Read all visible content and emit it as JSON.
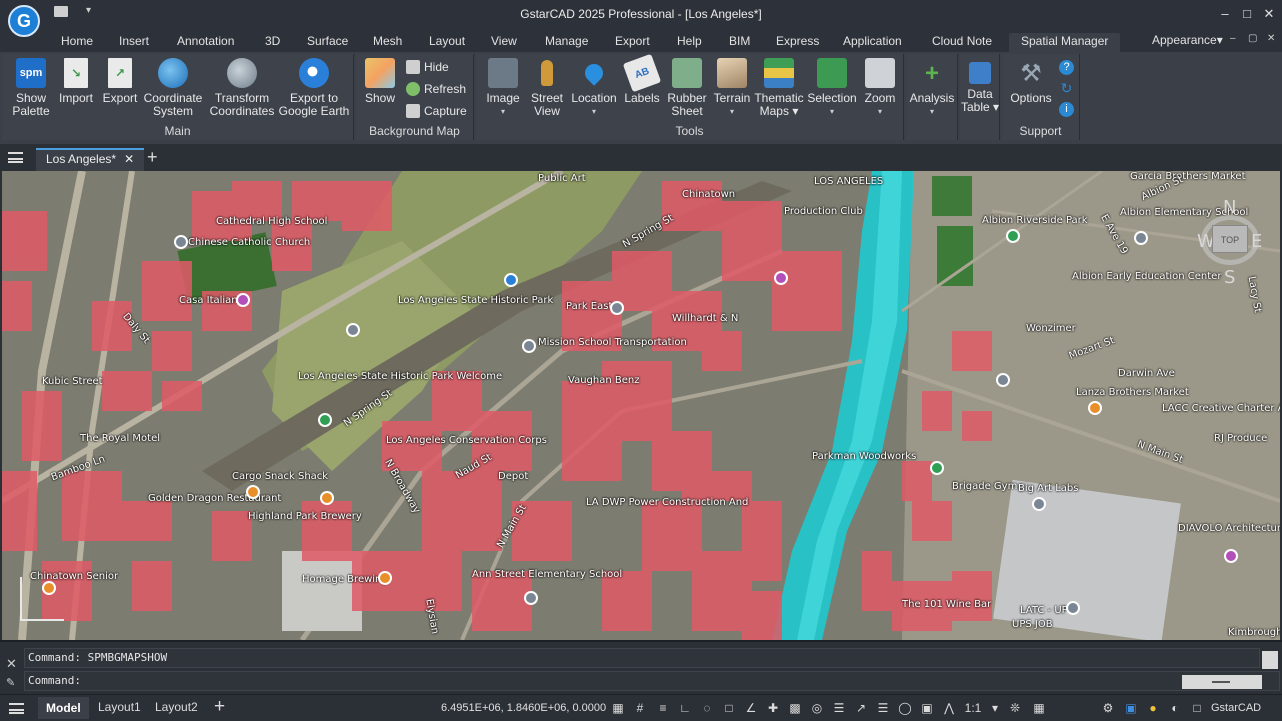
{
  "title_bar": {
    "title": "GstarCAD 2025 Professional - [Los Angeles*]",
    "logo_letter": "G",
    "quick_access_arrow": "▾",
    "window_buttons": [
      "–",
      "□",
      "✕"
    ]
  },
  "ribbon_tabs": [
    {
      "label": "Home",
      "active": false
    },
    {
      "label": "Insert",
      "active": false
    },
    {
      "label": "Annotation",
      "active": false
    },
    {
      "label": "3D",
      "active": false
    },
    {
      "label": "Surface",
      "active": false
    },
    {
      "label": "Mesh",
      "active": false
    },
    {
      "label": "Layout",
      "active": false
    },
    {
      "label": "View",
      "active": false
    },
    {
      "label": "Manage",
      "active": false
    },
    {
      "label": "Export",
      "active": false
    },
    {
      "label": "Help",
      "active": false
    },
    {
      "label": "BIM",
      "active": false
    },
    {
      "label": "Express",
      "active": false
    },
    {
      "label": "Application",
      "active": false
    },
    {
      "label": "Cloud Note",
      "active": false
    },
    {
      "label": "Spatial Manager",
      "active": true
    }
  ],
  "appearance_menu": "Appearance",
  "appearance_arrow": "▾",
  "ribbon_window_buttons": [
    "–",
    "▢",
    "✕"
  ],
  "panels": {
    "main": {
      "title": "Main",
      "buttons": [
        {
          "line1": "Show",
          "line2": "Palette",
          "icon": "spm",
          "icon_color": "#1f6fc9"
        },
        {
          "line1": "Import",
          "line2": "",
          "icon": "",
          "icon_color": "#e8e8e8"
        },
        {
          "line1": "Export",
          "line2": "",
          "icon": "",
          "icon_color": "#e8e8e8"
        },
        {
          "line1": "Coordinate",
          "line2": "System",
          "icon": "",
          "icon_color": "#2a8ad4"
        },
        {
          "line1": "Transform",
          "line2": "Coordinates",
          "icon": "",
          "icon_color": "#8a9aa8"
        },
        {
          "line1": "Export to",
          "line2": "Google Earth",
          "icon": "",
          "icon_color": "#2a7fd9"
        }
      ]
    },
    "background_map": {
      "title": "Background Map",
      "show_label": "Show",
      "small_buttons": [
        "Hide",
        "Refresh",
        "Capture"
      ]
    },
    "tools": {
      "title": "Tools",
      "buttons": [
        {
          "line1": "Image",
          "line2": "▾",
          "icon_color": "#6c7a88"
        },
        {
          "line1": "Street",
          "line2": "View",
          "icon_color": "#d09a3a"
        },
        {
          "line1": "Location",
          "line2": "▾",
          "icon_color": "#2b8fe0"
        },
        {
          "line1": "Labels",
          "line2": "",
          "icon_color": "#e8e8e8"
        },
        {
          "line1": "Rubber",
          "line2": "Sheet",
          "icon_color": "#7fae8a"
        },
        {
          "line1": "Terrain",
          "line2": "▾",
          "icon_color": "#b89a78"
        },
        {
          "line1": "Thematic",
          "line2": "Maps ▾",
          "icon_color": "#3f9e55"
        },
        {
          "line1": "Selection",
          "line2": "▾",
          "icon_color": "#3c9a52"
        },
        {
          "line1": "Zoom",
          "line2": "▾",
          "icon_color": "#cfd3d8"
        }
      ]
    },
    "analysis": {
      "title": "",
      "label": "Analysis",
      "arrow": "▾"
    },
    "data_table": {
      "title": "",
      "line1": "Data",
      "line2": "Table ▾"
    },
    "support": {
      "title": "Support",
      "label": "Options"
    }
  },
  "doc_tab": {
    "label": "Los Angeles*",
    "close": "✕",
    "add": "+"
  },
  "map_labels": [
    "Public Art",
    "Chinatown",
    "LOS ANGELES",
    "Garcia Brothers Market",
    "Albion St",
    "Albion Elementary School",
    "Cathedral High School",
    "Chinese Catholic Church",
    "N Spring St",
    "Production Club",
    "Albion Riverside Park",
    "Casa Italiana",
    "Los Angeles State Historic Park",
    "Park East",
    "Willhardt & N",
    "Albion Early Education Center",
    "Mission School Transportation",
    "Vaughan Benz",
    "Wonzimer",
    "Mozart St",
    "Darwin Ave",
    "Los Angeles State Historic Park Welcome",
    "Lanza Brothers Market",
    "Kubic Street",
    "The Royal Motel",
    "Bamboo Ln",
    "Los Angeles Conservation Corps",
    "Cargo Snack Shack",
    "Naud St",
    "Depot",
    "LA DWP Power Construction And",
    "Parkman Woodworks",
    "Brigade Gym",
    "Big Art Labs",
    "DIAVOLO Architecture in Motion",
    "Highland Park Brewery",
    "Homage Brewing",
    "Ann Street Elementary School",
    "N Main St",
    "The 101 Wine Bar",
    "LATC - UP",
    "UPS JOB",
    "N Spring St",
    "Golden Dragon Restaurant",
    "Daly St",
    "N Broadway",
    "E Ave 19",
    "Lacy St",
    "RJ Produce",
    "LACC Creative Charter Academy",
    "N Main St",
    "Elysian",
    "Chinatown Senior",
    "Kimbrough Studio"
  ],
  "viewcube": {
    "north": "N",
    "south": "S",
    "east": "E",
    "west": "W",
    "top": "TOP"
  },
  "command": {
    "history": "Command: SPMBGMAPSHOW",
    "prompt": "Command:"
  },
  "status_bar": {
    "tabs": [
      {
        "label": "Model",
        "active": true
      },
      {
        "label": "Layout1",
        "active": false
      },
      {
        "label": "Layout2",
        "active": false
      }
    ],
    "coordinates": "6.4951E+06, 1.8460E+06, 0.0000",
    "scale": "1:1",
    "product": "GstarCAD"
  }
}
